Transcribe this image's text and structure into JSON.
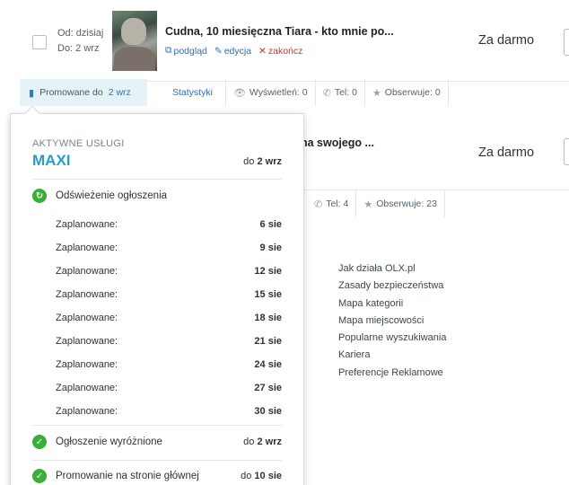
{
  "listing1": {
    "dates": [
      "Od: dzisiaj",
      "Do: 2 wrz"
    ],
    "title": "Cudna, 10 miesięczna Tiara - kto mnie po...",
    "actions": {
      "preview": "podgląd",
      "edit": "edycja",
      "finish": "zakończ"
    },
    "price": "Za darmo"
  },
  "statsbar1": {
    "promo_label": "Promowane do",
    "promo_date": "2 wrz",
    "stats_link": "Statystyki",
    "views": "Wyświetleń: 0",
    "phone": "Tel: 0",
    "watchers": "Obserwuje: 0"
  },
  "listing2": {
    "title": "na swojego ...",
    "price": "Za darmo"
  },
  "statsbar2": {
    "phone": "Tel: 4",
    "watchers": "Obserwuje: 23"
  },
  "footer_links": [
    "Jak działa OLX.pl",
    "Zasady bezpieczeństwa",
    "Mapa kategorii",
    "Mapa miejscowości",
    "Popularne wyszukiwania",
    "Kariera",
    "Preferencje Reklamowe"
  ],
  "popup": {
    "heading": "AKTYWNE USŁUGI",
    "plan": "MAXI",
    "until_prefix": "do",
    "until_date": "2 wrz",
    "refresh_label": "Odświeżenie ogłoszenia",
    "schedule": [
      {
        "label": "Zaplanowane:",
        "value": "6 sie"
      },
      {
        "label": "Zaplanowane:",
        "value": "9 sie"
      },
      {
        "label": "Zaplanowane:",
        "value": "12 sie"
      },
      {
        "label": "Zaplanowane:",
        "value": "15 sie"
      },
      {
        "label": "Zaplanowane:",
        "value": "18 sie"
      },
      {
        "label": "Zaplanowane:",
        "value": "21 sie"
      },
      {
        "label": "Zaplanowane:",
        "value": "24 sie"
      },
      {
        "label": "Zaplanowane:",
        "value": "27 sie"
      },
      {
        "label": "Zaplanowane:",
        "value": "30 sie"
      }
    ],
    "featured_label": "Ogłoszenie wyróżnione",
    "featured_prefix": "do",
    "featured_date": "2 wrz",
    "homepage_label": "Promowanie na stronie głównej",
    "homepage_prefix": "do",
    "homepage_date": "10 sie"
  },
  "colors": {
    "accent_blue": "#2a9bd1",
    "link_blue": "#2d6fb7",
    "success_green": "#3cae3c",
    "promo_bg": "#e5f3f7",
    "danger_red": "#c0392b"
  }
}
